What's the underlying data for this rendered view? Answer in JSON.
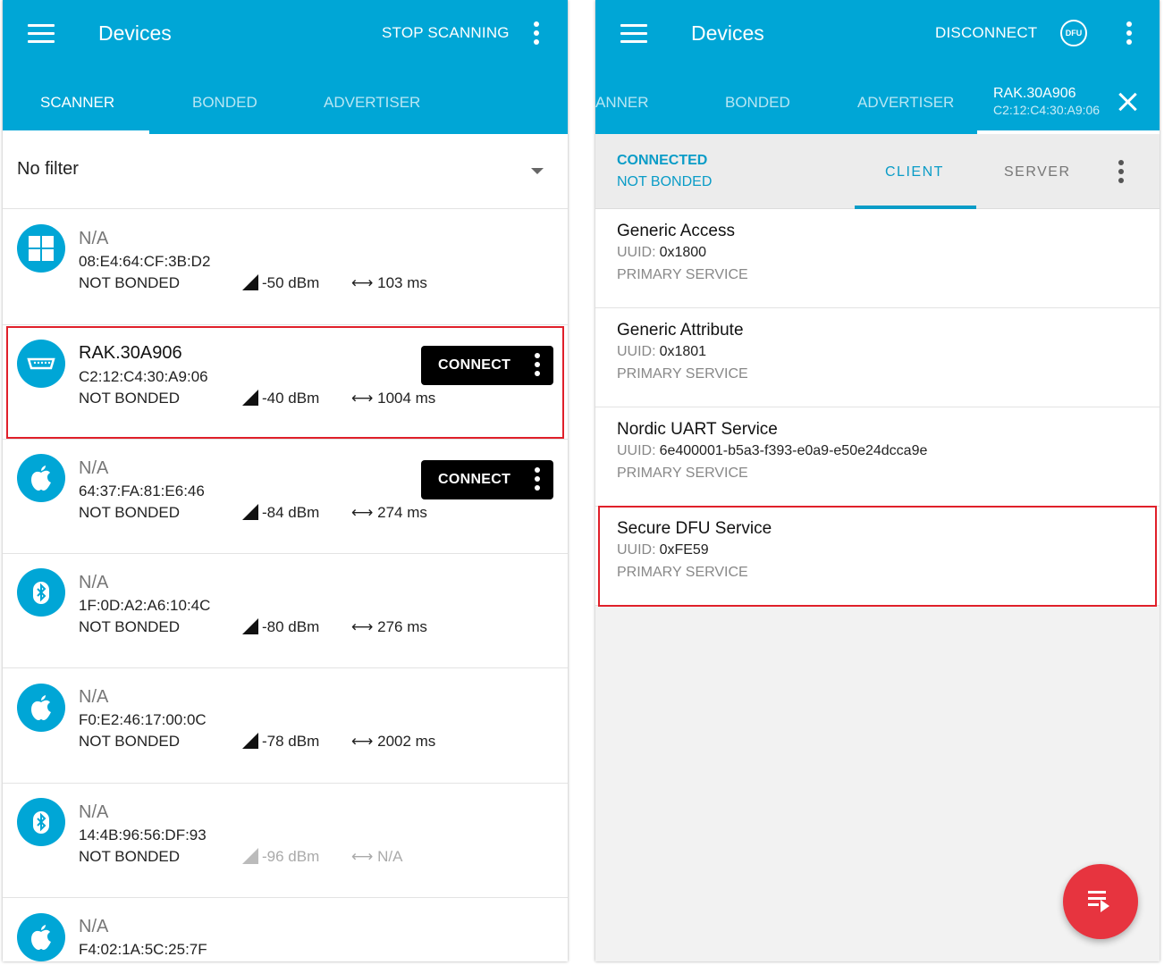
{
  "colors": {
    "primary": "#00a6d6",
    "accent": "#e7343f",
    "highlight": "#e0202a",
    "connected": "#0a9cc7"
  },
  "left": {
    "title": "Devices",
    "action": "STOP SCANNING",
    "tabs": [
      "SCANNER",
      "BONDED",
      "ADVERTISER"
    ],
    "filter": "No filter",
    "connect_label": "CONNECT",
    "devices": [
      {
        "icon": "windows-icon",
        "name": "N/A",
        "address": "08:E4:64:CF:3B:D2",
        "bond": "NOT BONDED",
        "rssi": "-50 dBm",
        "interval": "103 ms"
      },
      {
        "icon": "serial-port-icon",
        "name": "RAK.30A906",
        "address": "C2:12:C4:30:A9:06",
        "bond": "NOT BONDED",
        "rssi": "-40 dBm",
        "interval": "1004 ms"
      },
      {
        "icon": "apple-icon",
        "name": "N/A",
        "address": "64:37:FA:81:E6:46",
        "bond": "NOT BONDED",
        "rssi": "-84 dBm",
        "interval": "274 ms"
      },
      {
        "icon": "bluetooth-icon",
        "name": "N/A",
        "address": "1F:0D:A2:A6:10:4C",
        "bond": "NOT BONDED",
        "rssi": "-80 dBm",
        "interval": "276 ms"
      },
      {
        "icon": "apple-icon",
        "name": "N/A",
        "address": "F0:E2:46:17:00:0C",
        "bond": "NOT BONDED",
        "rssi": "-78 dBm",
        "interval": "2002 ms"
      },
      {
        "icon": "bluetooth-icon",
        "name": "N/A",
        "address": "14:4B:96:56:DF:93",
        "bond": "NOT BONDED",
        "rssi": "-96 dBm",
        "interval": "N/A"
      },
      {
        "icon": "apple-icon",
        "name": "N/A",
        "address": "F4:02:1A:5C:25:7F"
      }
    ]
  },
  "right": {
    "title": "Devices",
    "action": "DISCONNECT",
    "dfu_label": "DFU",
    "tabs": [
      "ANNER",
      "BONDED",
      "ADVERTISER"
    ],
    "device_tab": {
      "name": "RAK.30A906",
      "address": "C2:12:C4:30:A9:06"
    },
    "connection": "CONNECTED",
    "bond": "NOT BONDED",
    "subtabs": [
      "CLIENT",
      "SERVER"
    ],
    "uuid_label": "UUID:",
    "services": [
      {
        "name": "Generic Access",
        "uuid": "0x1800",
        "type": "PRIMARY SERVICE"
      },
      {
        "name": "Generic Attribute",
        "uuid": "0x1801",
        "type": "PRIMARY SERVICE"
      },
      {
        "name": "Nordic UART Service",
        "uuid": "6e400001-b5a3-f393-e0a9-e50e24dcca9e",
        "type": "PRIMARY SERVICE"
      },
      {
        "name": "Secure DFU Service",
        "uuid": "0xFE59",
        "type": "PRIMARY SERVICE"
      }
    ]
  }
}
